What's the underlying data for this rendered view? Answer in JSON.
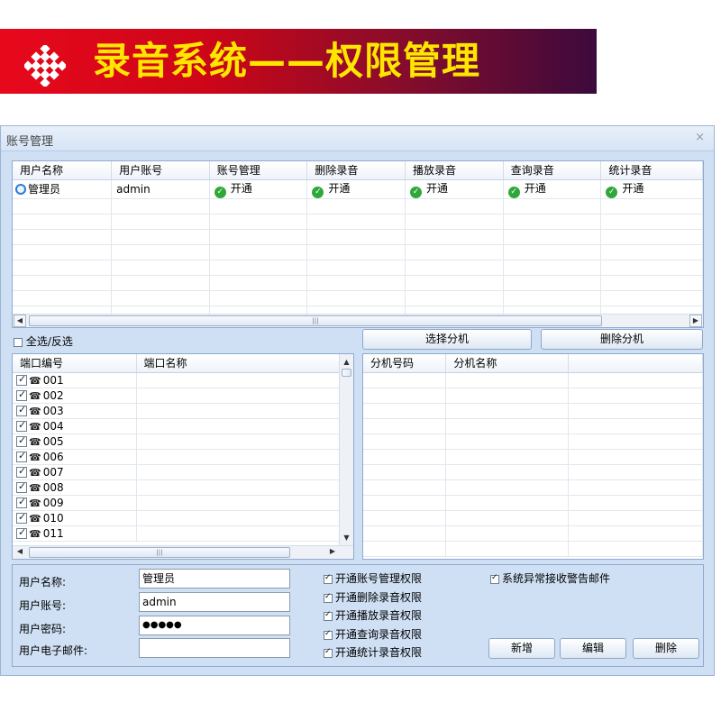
{
  "banner": {
    "title": "录音系统——权限管理"
  },
  "window": {
    "title": "账号管理",
    "close": "×"
  },
  "users_grid": {
    "columns": [
      "用户名称",
      "用户账号",
      "账号管理",
      "删除录音",
      "播放录音",
      "查询录音",
      "统计录音"
    ],
    "rows": [
      {
        "name": "管理员",
        "account": "admin",
        "perms": [
          "开通",
          "开通",
          "开通",
          "开通",
          "开通"
        ]
      }
    ]
  },
  "select_all": {
    "label": "全选/反选",
    "checked": false
  },
  "buttons": {
    "select_ext": "选择分机",
    "delete_ext": "删除分机",
    "add": "新增",
    "edit": "编辑",
    "delete": "删除"
  },
  "ports_grid": {
    "columns": [
      "端口编号",
      "端口名称"
    ],
    "rows": [
      "001",
      "002",
      "003",
      "004",
      "005",
      "006",
      "007",
      "008",
      "009",
      "010",
      "011"
    ]
  },
  "ext_grid": {
    "columns": [
      "分机号码",
      "分机名称"
    ]
  },
  "form": {
    "username_label": "用户名称:",
    "username": "管理员",
    "account_label": "用户账号:",
    "account": "admin",
    "password_label": "用户密码:",
    "password": "●●●●●",
    "email_label": "用户电子邮件:",
    "email": "",
    "permissions": [
      {
        "label": "开通账号管理权限",
        "checked": true
      },
      {
        "label": "开通删除录音权限",
        "checked": true
      },
      {
        "label": "开通播放录音权限",
        "checked": true
      },
      {
        "label": "开通查询录音权限",
        "checked": true
      },
      {
        "label": "开通统计录音权限",
        "checked": true
      }
    ],
    "alert_email": {
      "label": "系统异常接收警告邮件",
      "checked": true
    }
  }
}
